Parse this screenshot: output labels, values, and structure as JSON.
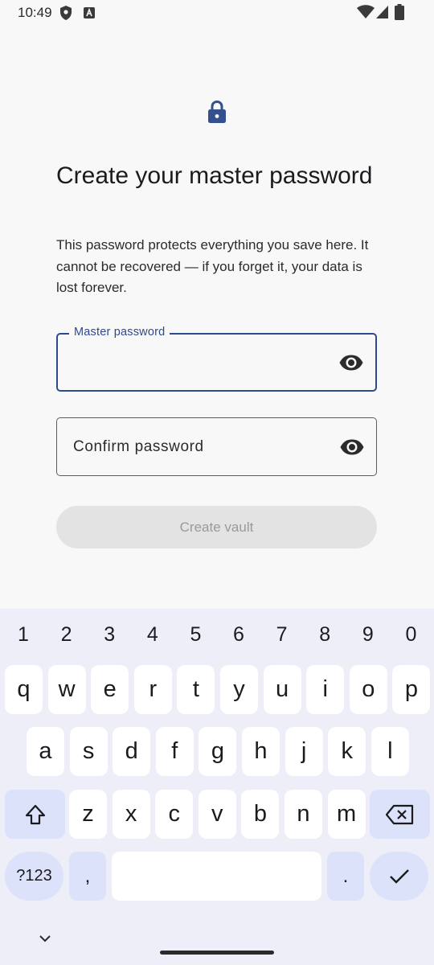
{
  "status_bar": {
    "time": "10:49",
    "left_icons": [
      "shield-icon",
      "a-badge-icon"
    ],
    "right_icons": [
      "wifi-icon",
      "signal-icon",
      "battery-icon"
    ]
  },
  "header": {
    "icon": "lock-icon",
    "title": "Create your master password",
    "description": "This password protects everything you save here. It cannot be recovered — if you forget it, your data is lost forever."
  },
  "form": {
    "master_password": {
      "label": "Master password",
      "value": "",
      "toggle_icon": "eye-icon"
    },
    "confirm_password": {
      "placeholder": "Confirm password",
      "value": "",
      "toggle_icon": "eye-icon"
    },
    "submit_label": "Create vault"
  },
  "keyboard": {
    "number_row": [
      "1",
      "2",
      "3",
      "4",
      "5",
      "6",
      "7",
      "8",
      "9",
      "0"
    ],
    "row1": [
      "q",
      "w",
      "e",
      "r",
      "t",
      "y",
      "u",
      "i",
      "o",
      "p"
    ],
    "row2": [
      "a",
      "s",
      "d",
      "f",
      "g",
      "h",
      "j",
      "k",
      "l"
    ],
    "row3": [
      "z",
      "x",
      "c",
      "v",
      "b",
      "n",
      "m"
    ],
    "symbols_label": "?123",
    "comma_label": ",",
    "period_label": ".",
    "shift_icon": "shift-icon",
    "backspace_icon": "backspace-icon",
    "enter_icon": "check-icon",
    "hide_icon": "chevron-down-icon"
  },
  "colors": {
    "accent": "#2e4a8f",
    "background": "#f8f8f8",
    "keyboard_bg": "#edeef7",
    "key_mod": "#dce2f9",
    "button_disabled": "#e3e3e3"
  }
}
